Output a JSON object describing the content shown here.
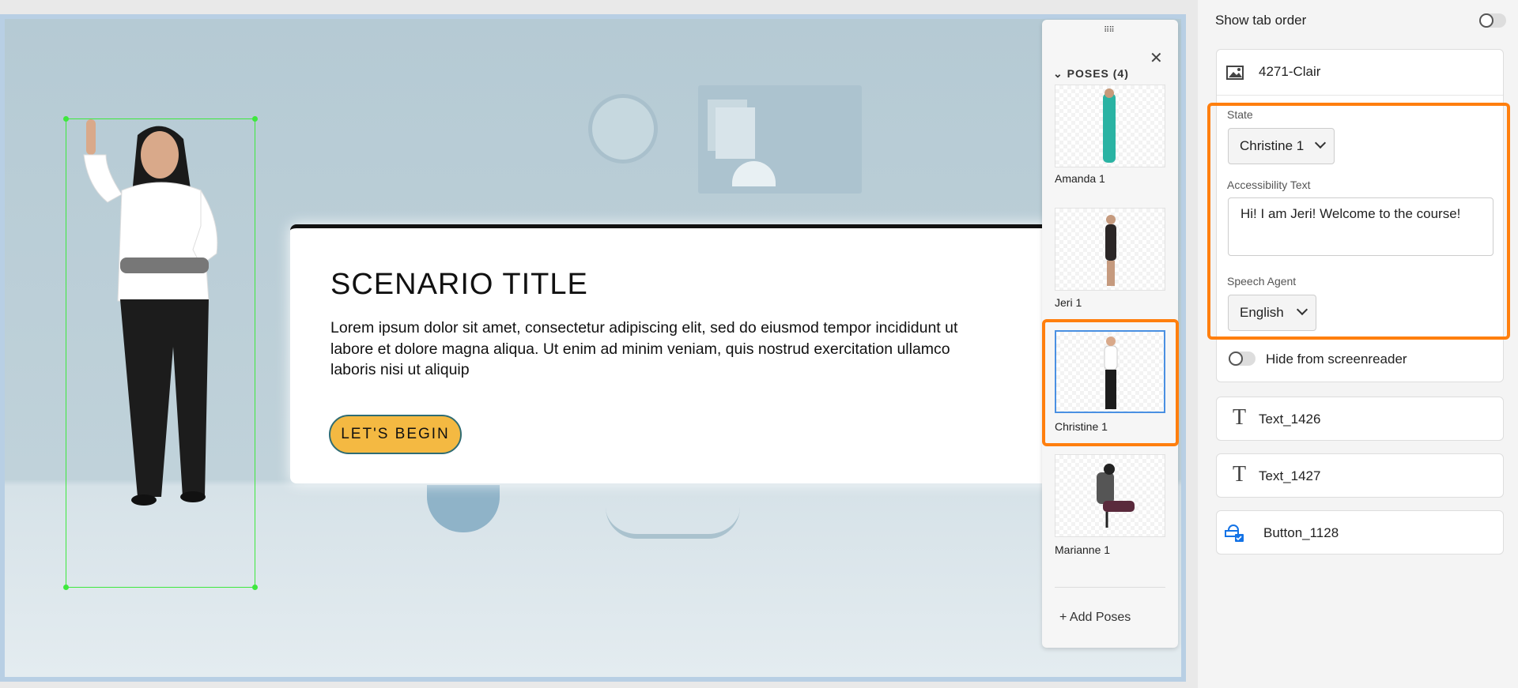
{
  "canvas": {
    "card": {
      "title": "SCENARIO TITLE",
      "body_lines": [
        "Lorem ipsum dolor sit amet, consectetur adipiscing elit, sed do eiusmod tempor incididunt ut",
        "labore et dolore magna aliqua. Ut enim ad minim veniam, quis nostrud exercitation ullamco",
        "laboris nisi ut aliquip"
      ],
      "button_label": "LET'S BEGIN"
    }
  },
  "poses_panel": {
    "header": "POSES (4)",
    "items": [
      {
        "label": "Amanda 1",
        "selected": false
      },
      {
        "label": "Jeri 1",
        "selected": false
      },
      {
        "label": "Christine 1",
        "selected": true
      },
      {
        "label": "Marianne 1",
        "selected": false
      }
    ],
    "add_label": "+ Add Poses"
  },
  "right_panel": {
    "show_tab_order": {
      "label": "Show tab order",
      "on": false
    },
    "image_item": {
      "name": "4271-Clair",
      "icon": "image-icon"
    },
    "state": {
      "label": "State",
      "value": "Christine 1"
    },
    "accessibility": {
      "label": "Accessibility Text",
      "value": "Hi! I am Jeri! Welcome to the course!"
    },
    "speech_agent": {
      "label": "Speech Agent",
      "value": "English"
    },
    "hide_screenreader": {
      "label": "Hide from screenreader",
      "on": false
    },
    "items": [
      {
        "name": "Text_1426",
        "icon": "text-icon"
      },
      {
        "name": "Text_1427",
        "icon": "text-icon"
      },
      {
        "name": "Button_1128",
        "icon": "button-icon"
      }
    ]
  },
  "colors": {
    "highlight": "#ff7f0e",
    "selection": "#3ee83e",
    "button": "#f4b942"
  }
}
